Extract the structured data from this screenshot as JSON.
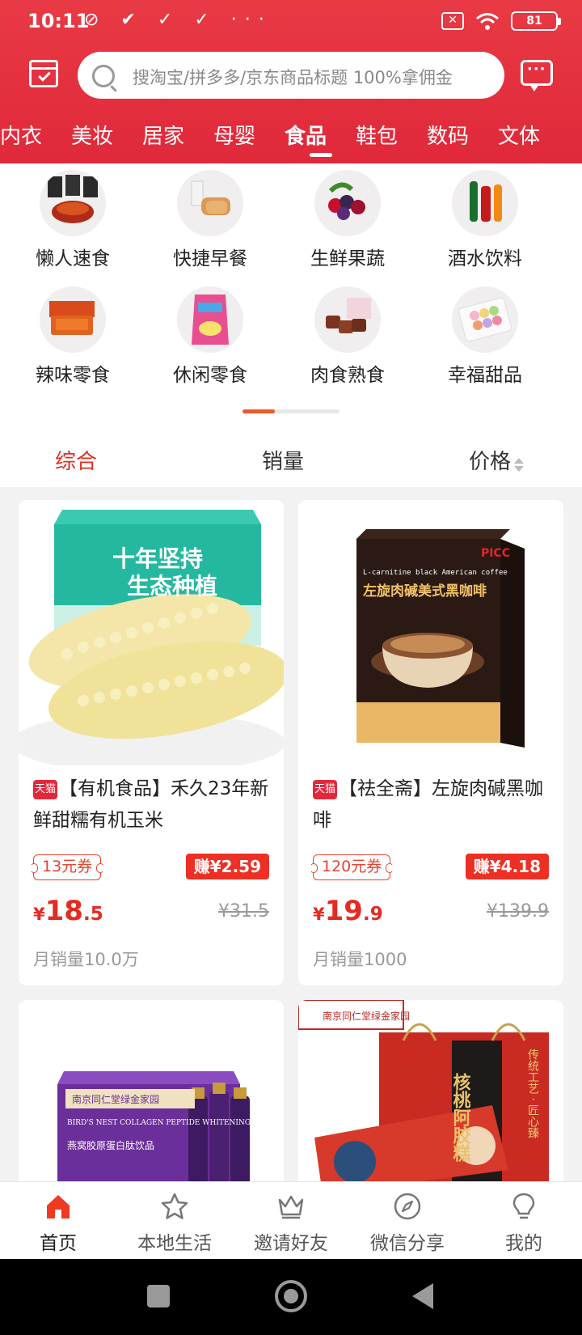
{
  "status_bar": {
    "time": "10:11",
    "left_icons": "⊘ ✔ ✓ ✓ ···",
    "battery": "81",
    "sim_icon": "sim-off-icon",
    "wifi_icon": "wifi-icon"
  },
  "search": {
    "placeholder": "搜淘宝/拼多多/京东商品标题 100%拿佣金"
  },
  "category_tabs": [
    "内衣",
    "美妆",
    "居家",
    "母婴",
    "食品",
    "鞋包",
    "数码",
    "文体"
  ],
  "active_tab": "食品",
  "subcategories": [
    {
      "label": "懒人速食",
      "icon": "instant-food-icon"
    },
    {
      "label": "快捷早餐",
      "icon": "breakfast-icon"
    },
    {
      "label": "生鲜果蔬",
      "icon": "fruit-icon"
    },
    {
      "label": "酒水饮料",
      "icon": "drinks-icon"
    },
    {
      "label": "辣味零食",
      "icon": "spicy-snack-icon"
    },
    {
      "label": "休闲零食",
      "icon": "snack-icon"
    },
    {
      "label": "肉食熟食",
      "icon": "meat-icon"
    },
    {
      "label": "幸福甜品",
      "icon": "dessert-icon"
    }
  ],
  "sort": {
    "comprehensive": "综合",
    "sales": "销量",
    "price": "价格"
  },
  "products": [
    {
      "badge": "天猫",
      "title": "【有机食品】禾久23年新鲜甜糯有机玉米",
      "coupon": "13元券",
      "earn": "赚¥2.59",
      "price_yen": "¥",
      "price_int": "18",
      "price_dec": ".5",
      "old_price": "¥31.5",
      "sales": "月销量10.0万",
      "image_text_1": "十年坚持",
      "image_text_2": "生态种植"
    },
    {
      "badge": "天猫",
      "title": "【祛全斋】左旋肉碱黑咖啡",
      "coupon": "120元券",
      "earn": "赚¥4.18",
      "price_yen": "¥",
      "price_int": "19",
      "price_dec": ".9",
      "old_price": "¥139.9",
      "sales": "月销量1000",
      "image_text_1": "PICC",
      "image_text_2": "L-carnitine black American coffee",
      "image_text_3": "左旋肉碱美式黑咖啡"
    },
    {
      "image_text_1": "南京同仁堂绿金家园",
      "image_text_2": "BIRD'S NEST COLLAGEN PEPTIDE WHITENING DRINK",
      "image_text_3": "燕窝胶原蛋白肽饮品"
    },
    {
      "image_text_1": "南京同仁堂绿金家园",
      "image_text_2": "核桃阿胶糕",
      "image_text_3": "传统工艺 · 匠心臻"
    }
  ],
  "bottom_nav": [
    {
      "label": "首页",
      "icon": "home-icon"
    },
    {
      "label": "本地生活",
      "icon": "star-icon"
    },
    {
      "label": "邀请好友",
      "icon": "crown-icon"
    },
    {
      "label": "微信分享",
      "icon": "compass-icon"
    },
    {
      "label": "我的",
      "icon": "bulb-icon"
    }
  ],
  "colors": {
    "header": "#e0283a",
    "accent": "#e02e24",
    "price": "#e52b21"
  }
}
